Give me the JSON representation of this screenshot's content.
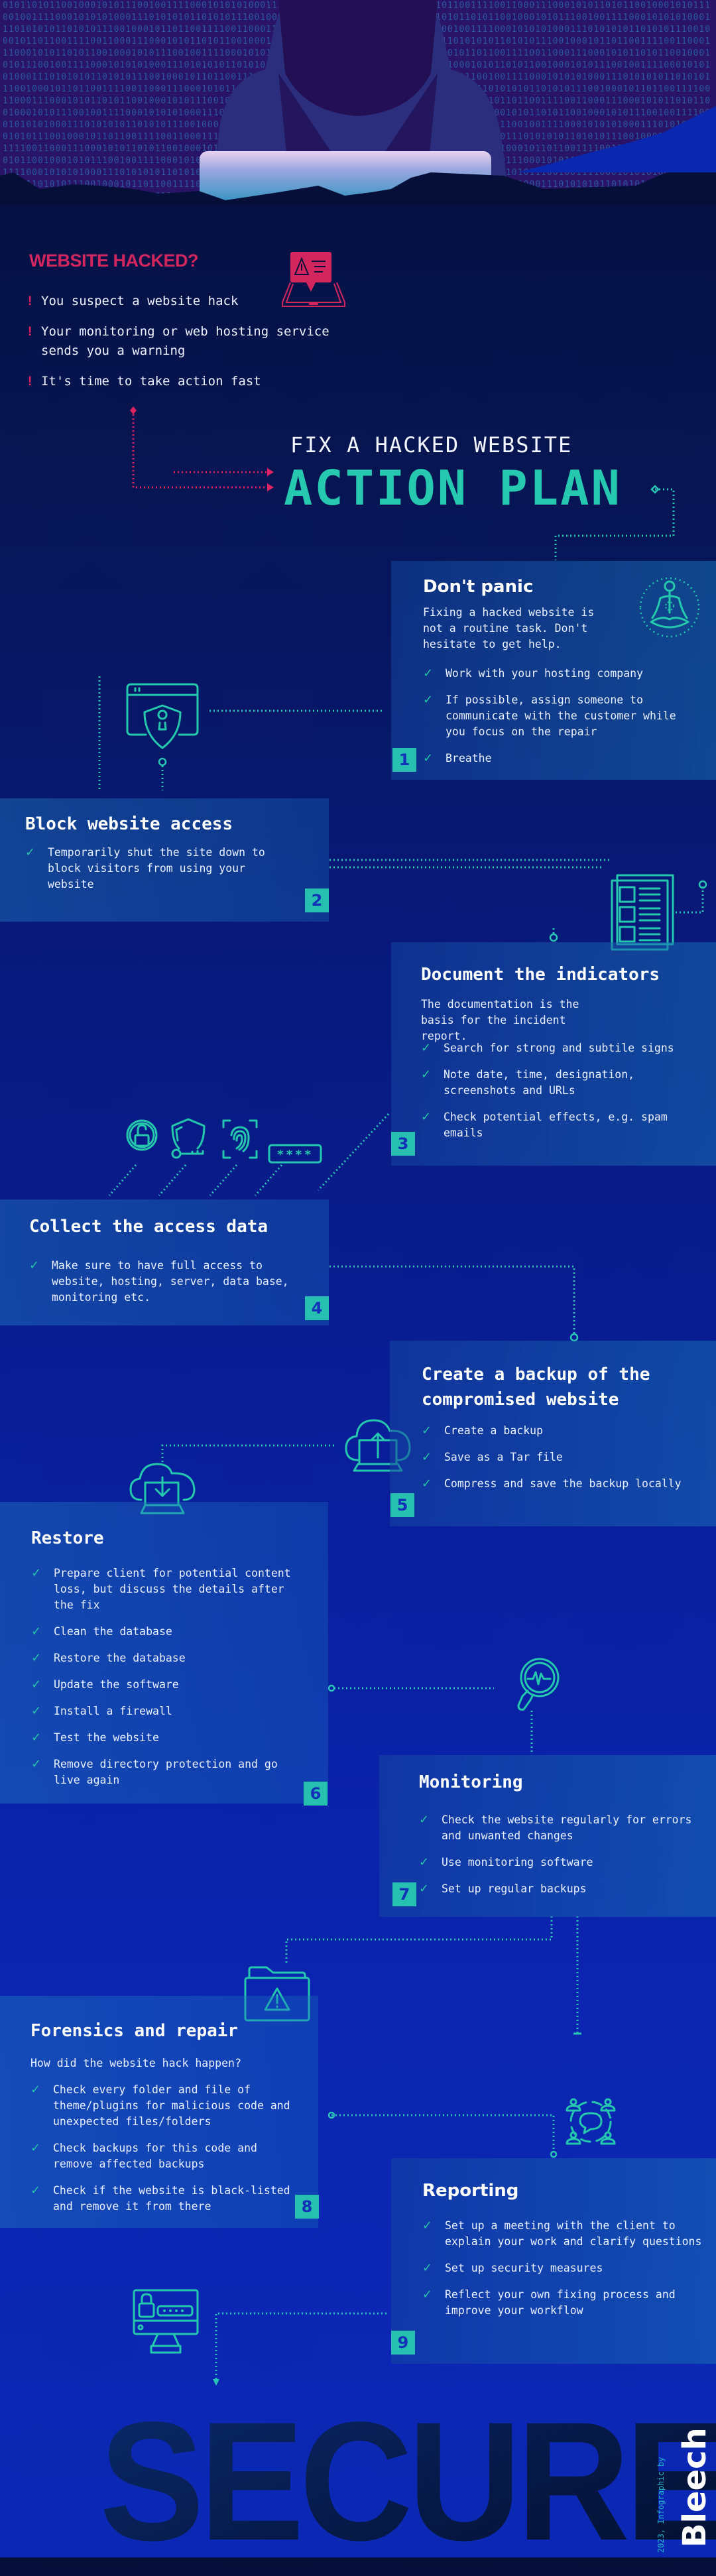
{
  "intro": {
    "title": "WEBSITE HACKED?",
    "alerts": [
      "You suspect a website hack",
      "Your monitoring or web hosting service sends you a warning",
      "It's time to take action fast"
    ]
  },
  "headline": {
    "kicker": "FIX A HACKED WEBSITE",
    "title": "ACTION PLAN"
  },
  "steps": [
    {
      "number": "1",
      "title": "Don't panic",
      "lead": "Fixing a hacked website is not a routine task. Don't hesitate to get help.",
      "items": [
        "Work with your hosting company",
        "If possible, assign someone to communicate with the customer while you focus on the repair",
        "Breathe"
      ],
      "icon": "meditation-icon"
    },
    {
      "number": "2",
      "title": "Block website access",
      "items": [
        "Temporarily shut the site down to block visitors from using your website"
      ],
      "icon": "browser-shield-lock-icon"
    },
    {
      "number": "3",
      "title": "Document the indicators",
      "lead": "The documentation is the basis for the incident report.",
      "items": [
        "Search for strong and subtile signs",
        "Note date, time, designation, screenshots and URLs",
        "Check potential effects, e.g. spam emails"
      ],
      "icon": "documents-icon"
    },
    {
      "number": "4",
      "title": "Collect the access data",
      "items": [
        "Make sure to have full access to website, hosting, server, data base, monitoring etc."
      ],
      "icon_labels": [
        "padlock-icon",
        "shield-key-icon",
        "fingerprint-icon",
        "password-field-icon"
      ],
      "password_mask": "****"
    },
    {
      "number": "5",
      "title": "Create a backup of the compromised website",
      "items": [
        "Create a backup",
        "Save as a Tar file",
        "Compress and save the backup locally"
      ],
      "icon": "cloud-upload-laptop-icon"
    },
    {
      "number": "6",
      "title": "Restore",
      "items": [
        "Prepare client for potential content loss, but discuss the details after the fix",
        "Clean the database",
        "Restore the database",
        "Update the software",
        "Install a firewall",
        "Test the website",
        "Remove directory protection and go live again"
      ],
      "icon": "cloud-download-laptop-icon"
    },
    {
      "number": "7",
      "title": "Monitoring",
      "items": [
        "Check the website regularly for errors and unwanted changes",
        "Use monitoring software",
        "Set up regular backups"
      ],
      "icon": "magnifier-pulse-icon"
    },
    {
      "number": "8",
      "title": "Forensics and repair",
      "lead": "How did the website hack happen?",
      "items": [
        "Check every folder and file of theme/plugins for malicious code and unexpected files/folders",
        "Check backups for this code and remove affected backups",
        "Check if the website is black-listed and remove it from there"
      ],
      "icon": "folder-warning-icon"
    },
    {
      "number": "9",
      "title": "Reporting",
      "items": [
        "Set up a meeting with the client to explain your work and clarify questions",
        "Set up security measures",
        "Reflect your own fixing process and improve your workflow"
      ],
      "icon": "meeting-chat-icon"
    }
  ],
  "footer": {
    "word": "SECURE",
    "credit": "2023, Infographic by",
    "brand": "Bleech"
  },
  "colors": {
    "accent_teal": "#26c9b0",
    "alert_pink": "#d4265e",
    "number_badge": "#26bfb0",
    "number_text": "#1231b8"
  }
}
